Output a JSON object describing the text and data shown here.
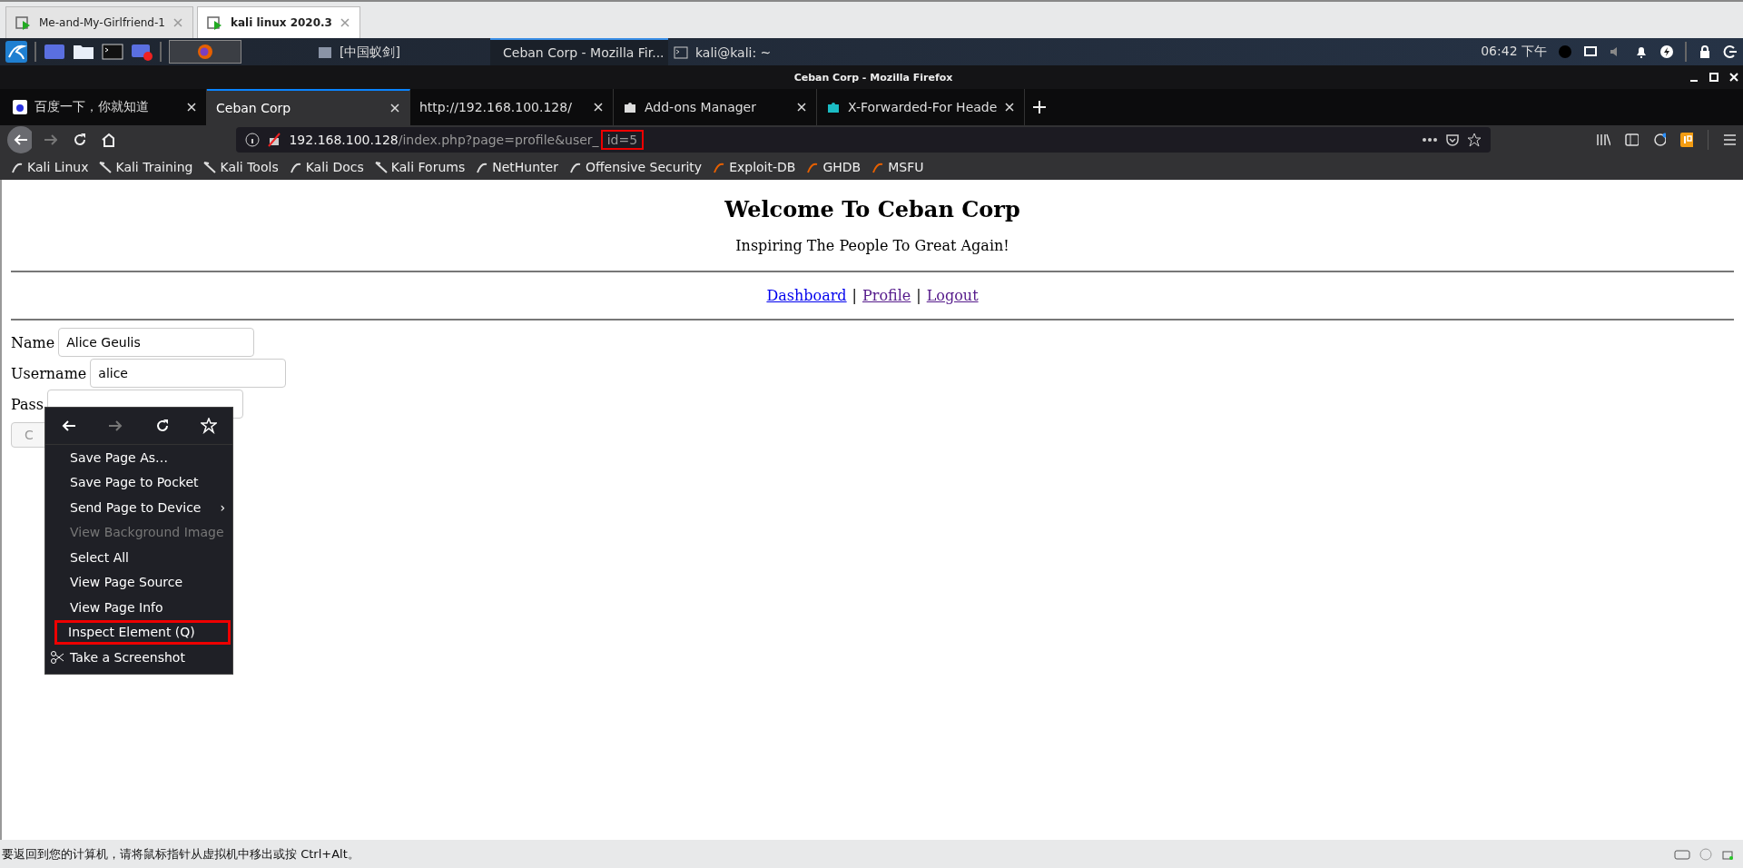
{
  "vm_tabs": [
    {
      "label": "Me-and-My-Girlfriend-1",
      "selected": false
    },
    {
      "label": "kali linux 2020.3",
      "selected": true
    }
  ],
  "taskbar": {
    "windows": [
      {
        "label": "[中国蚁剑]",
        "selected": false
      },
      {
        "label": "Ceban Corp - Mozilla Fir...",
        "selected": true
      },
      {
        "label": "kali@kali: ~",
        "selected": false
      }
    ],
    "clock": "06:42 下午"
  },
  "window": {
    "title": "Ceban Corp - Mozilla Firefox"
  },
  "tabs": [
    {
      "label": "百度一下，你就知道",
      "selected": false
    },
    {
      "label": "Ceban Corp",
      "selected": true
    },
    {
      "label": "http://192.168.100.128/",
      "selected": false
    },
    {
      "label": "Add-ons Manager",
      "selected": false
    },
    {
      "label": "X-Forwarded-For Heade",
      "selected": false
    }
  ],
  "url": {
    "host": "192.168.100.128",
    "path": "/index.php?page=profile&user_",
    "highlighted_part": "id=5"
  },
  "bookmarks": [
    "Kali Linux",
    "Kali Training",
    "Kali Tools",
    "Kali Docs",
    "Kali Forums",
    "NetHunter",
    "Offensive Security",
    "Exploit-DB",
    "GHDB",
    "MSFU"
  ],
  "page": {
    "heading": "Welcome To Ceban Corp",
    "subtitle": "Inspiring The People To Great Again!",
    "links": [
      {
        "label": "Dashboard",
        "visited": false
      },
      {
        "label": "Profile",
        "visited": true
      },
      {
        "label": "Logout",
        "visited": true
      }
    ],
    "separator": "|",
    "form": [
      {
        "label": "Name",
        "value": "Alice Geulis"
      },
      {
        "label": "Username",
        "value": "alice"
      },
      {
        "label": "Pass"
      }
    ],
    "button": "C"
  },
  "context_menu": {
    "items": [
      {
        "label": "Save Page As…",
        "disabled": false,
        "highlighted": false,
        "submenu": false
      },
      {
        "label": "Save Page to Pocket",
        "disabled": false,
        "highlighted": false,
        "submenu": false
      },
      {
        "label": "Send Page to Device",
        "disabled": false,
        "highlighted": false,
        "submenu": true
      },
      {
        "label": "View Background Image",
        "disabled": true,
        "highlighted": false,
        "submenu": false
      },
      {
        "label": "Select All",
        "disabled": false,
        "highlighted": false,
        "submenu": false
      },
      {
        "label": "View Page Source",
        "disabled": false,
        "highlighted": false,
        "submenu": false
      },
      {
        "label": "View Page Info",
        "disabled": false,
        "highlighted": false,
        "submenu": false
      },
      {
        "label": "Inspect Element (Q)",
        "disabled": false,
        "highlighted": true,
        "submenu": false
      },
      {
        "label": "Take a Screenshot",
        "disabled": false,
        "highlighted": false,
        "submenu": false
      }
    ],
    "submenu_arrow": "›"
  },
  "status_bar": "要返回到您的计算机，请将鼠标指针从虚拟机中移出或按 Ctrl+Alt。"
}
